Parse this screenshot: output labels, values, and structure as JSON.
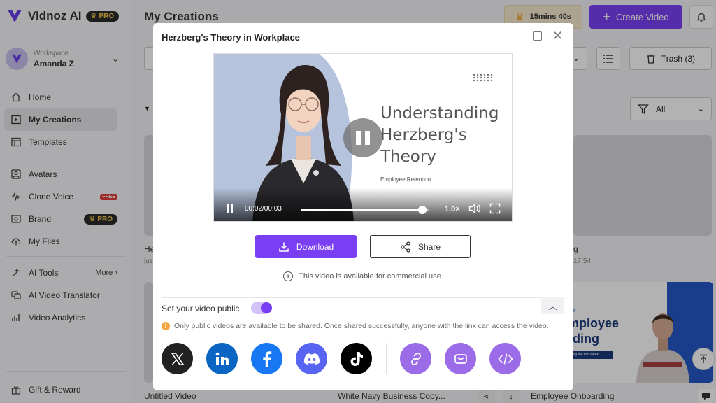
{
  "app": {
    "logo_text": "Vidnoz AI",
    "pro_badge": "PRO",
    "brand_color": "#7a3ff2"
  },
  "workspace": {
    "label": "Workspace",
    "name": "Amanda Z"
  },
  "sidebar": {
    "items": [
      {
        "label": "Home",
        "icon": "home-icon"
      },
      {
        "label": "My Creations",
        "icon": "play-box-icon",
        "active": true
      },
      {
        "label": "Templates",
        "icon": "template-icon"
      },
      {
        "label": "Avatars",
        "icon": "avatar-icon"
      },
      {
        "label": "Clone Voice",
        "icon": "voice-icon",
        "badge": "FREE"
      },
      {
        "label": "Brand",
        "icon": "brand-icon",
        "badge": "PRO"
      },
      {
        "label": "My Files",
        "icon": "upload-icon"
      },
      {
        "label": "AI Tools",
        "icon": "tools-icon",
        "more": "More"
      },
      {
        "label": "AI Video Translator",
        "icon": "translator-icon"
      },
      {
        "label": "Video Analytics",
        "icon": "analytics-icon"
      }
    ],
    "gift": "Gift & Reward"
  },
  "header": {
    "title": "My Creations",
    "time_left": "15mins 40s",
    "create_label": "Create Video",
    "trash_label": "Trash (3)",
    "filter_value": "All"
  },
  "cards": {
    "c1_title": "He",
    "c1_sub": "jus",
    "c2_title": "g",
    "c2_sub": "17:54",
    "bottom": [
      "Untitled Video",
      "White Navy Business Copy...",
      "Employee Onboarding"
    ],
    "employee_text_1": "mployee",
    "employee_text_2": "rding",
    "employee_small": "ent",
    "employee_tiny": "uring the first week"
  },
  "modal": {
    "title": "Herzberg's Theory in Workplace",
    "video": {
      "title_lines": [
        "Understanding",
        "Herzberg's",
        "Theory"
      ],
      "subtitle": "Employee Retention",
      "time": "00:02/00:03",
      "progress": 0.95,
      "speed": "1.0×"
    },
    "download_label": "Download",
    "share_label": "Share",
    "commercial_note": "This video is available for commercial use.",
    "public_label": "Set your video public",
    "public_on": true,
    "notice": "Only public videos are available to be shared. Once shared successfully, anyone with the link can access the video.",
    "socials": [
      {
        "name": "x",
        "color": "#222222"
      },
      {
        "name": "linkedin",
        "color": "#0a66c2"
      },
      {
        "name": "facebook",
        "color": "#1877f2"
      },
      {
        "name": "discord",
        "color": "#5865f2"
      },
      {
        "name": "tiktok",
        "color": "#000000"
      },
      {
        "name": "link",
        "color": "#9b6be8"
      },
      {
        "name": "email",
        "color": "#9b6be8"
      },
      {
        "name": "embed",
        "color": "#9b6be8"
      }
    ]
  }
}
